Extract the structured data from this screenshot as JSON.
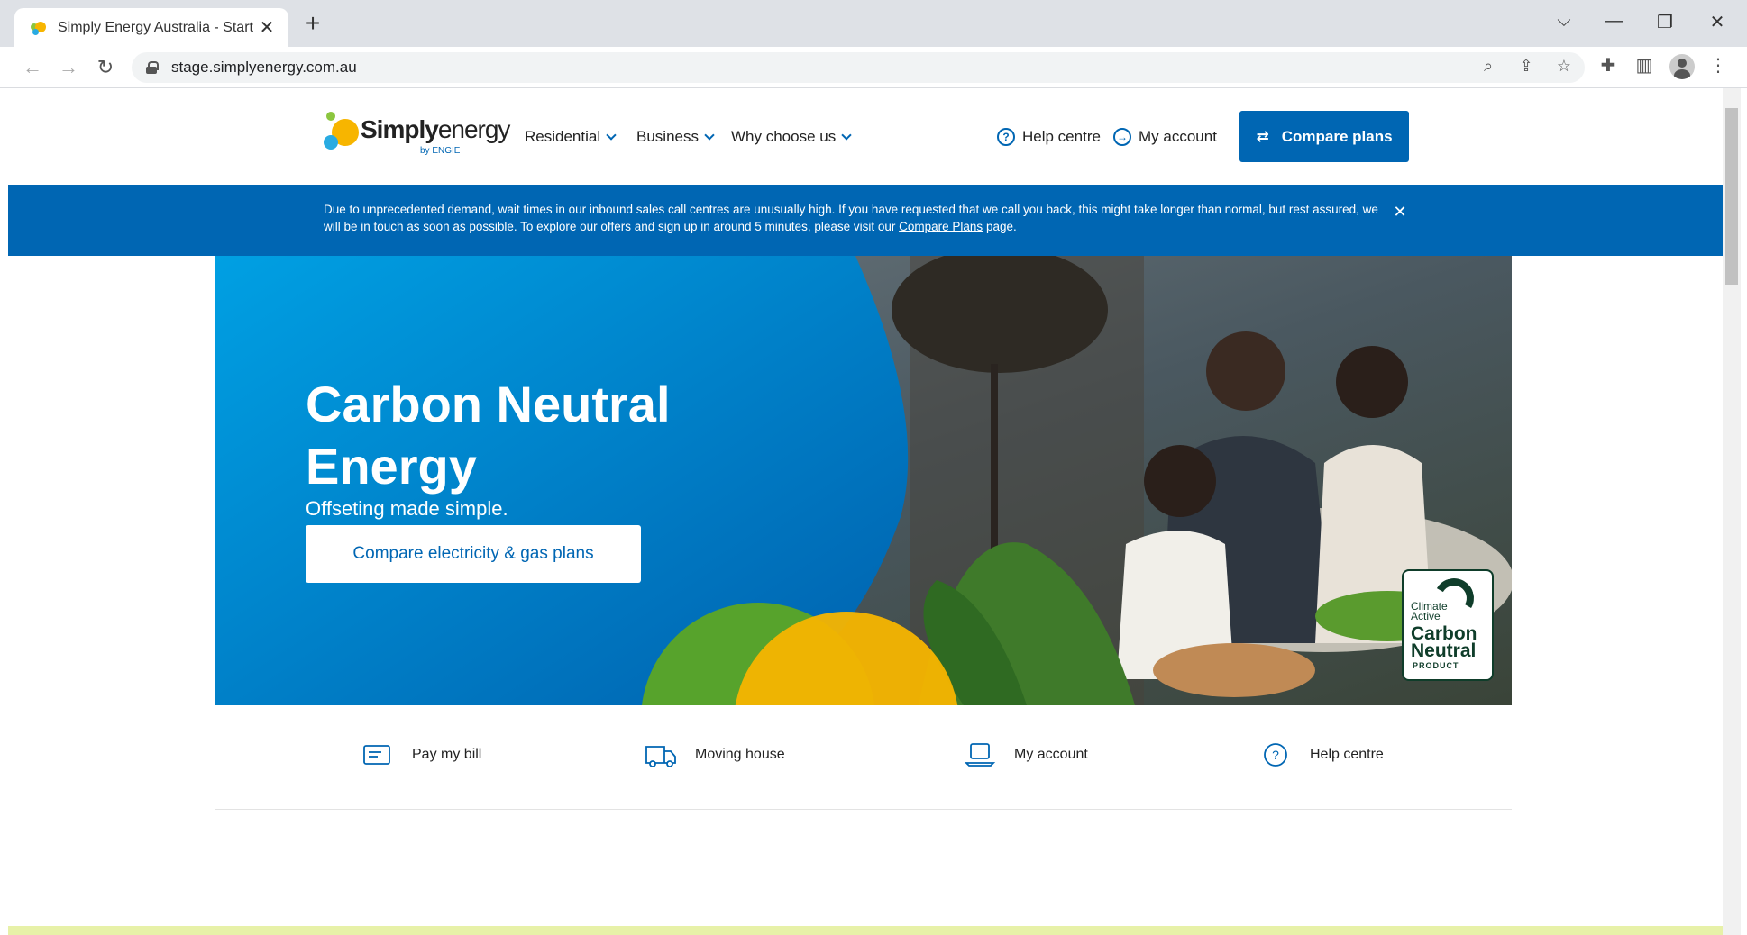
{
  "browser": {
    "tab_title": "Simply Energy Australia - Start To",
    "url": "stage.simplyenergy.com.au"
  },
  "header": {
    "logo_text_a": "Simply",
    "logo_text_b": "energy",
    "logo_sub": "by ENGIE",
    "nav": [
      "Residential",
      "Business",
      "Why choose us"
    ],
    "help_label": "Help centre",
    "account_label": "My account",
    "cta_label": "Compare plans"
  },
  "banner": {
    "text_before": "Due to unprecedented demand, wait times in our inbound sales call centres are unusually high. If you have requested that we call you back, this might take longer than normal, but rest assured, we will be in touch as soon as possible. To explore our offers and sign up in around 5 minutes, please visit our ",
    "link": "Compare Plans",
    "text_after": " page."
  },
  "hero": {
    "title": "Carbon Neutral Energy",
    "subtitle": "Offseting made simple.",
    "button_label": "Compare electricity & gas plans",
    "badge_line1": "Climate Active",
    "badge_line2": "Carbon Neutral",
    "badge_line3": "PRODUCT"
  },
  "quick_links": [
    {
      "label": "Pay my bill",
      "icon": "card-icon"
    },
    {
      "label": "Moving house",
      "icon": "truck-icon"
    },
    {
      "label": "My account",
      "icon": "laptop-icon"
    },
    {
      "label": "Help centre",
      "icon": "question-icon"
    }
  ],
  "colors": {
    "brand_blue": "#0066b3",
    "badge_green": "#0f3d2a",
    "footer_strip": "#e7f1a8"
  }
}
